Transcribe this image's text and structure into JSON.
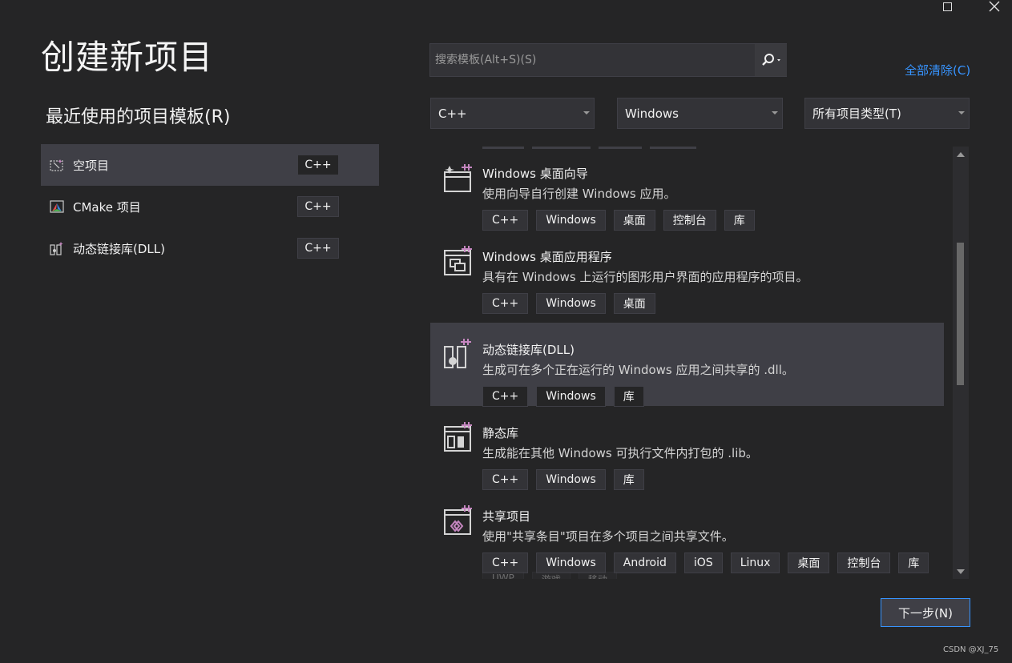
{
  "page": {
    "title": "创建新项目"
  },
  "recent": {
    "heading": "最近使用的项目模板(R)",
    "items": [
      {
        "name": "空项目",
        "lang": "C++"
      },
      {
        "name": "CMake 项目",
        "lang": "C++"
      },
      {
        "name": "动态链接库(DLL)",
        "lang": "C++"
      }
    ]
  },
  "search": {
    "placeholder": "搜索模板(Alt+S)(S)"
  },
  "clear_all": "全部清除(C)",
  "filters": {
    "language": "C++",
    "platform": "Windows",
    "project_type": "所有项目类型(T)"
  },
  "templates": [
    {
      "title": "Windows 桌面向导",
      "desc": "使用向导自行创建 Windows 应用。",
      "tags": [
        "C++",
        "Windows",
        "桌面",
        "控制台",
        "库"
      ]
    },
    {
      "title": "Windows 桌面应用程序",
      "desc": "具有在 Windows 上运行的图形用户界面的应用程序的项目。",
      "tags": [
        "C++",
        "Windows",
        "桌面"
      ]
    },
    {
      "title": "动态链接库(DLL)",
      "desc": "生成可在多个正在运行的 Windows 应用之间共享的 .dll。",
      "tags": [
        "C++",
        "Windows",
        "库"
      ]
    },
    {
      "title": "静态库",
      "desc": "生成能在其他 Windows 可执行文件内打包的 .lib。",
      "tags": [
        "C++",
        "Windows",
        "库"
      ]
    },
    {
      "title": "共享项目",
      "desc": "使用\"共享条目\"项目在多个项目之间共享文件。",
      "tags": [
        "C++",
        "Windows",
        "Android",
        "iOS",
        "Linux",
        "桌面",
        "控制台",
        "库"
      ]
    }
  ],
  "faded_tags": [
    "UWP",
    "游戏",
    "移动"
  ],
  "next_button": "下一步(N)",
  "watermark": "CSDN @XJ_75",
  "colors": {
    "accent": "#3794ff",
    "selected_bg": "#3f3f46",
    "background": "#252526",
    "icon_purple": "#c586c0"
  }
}
